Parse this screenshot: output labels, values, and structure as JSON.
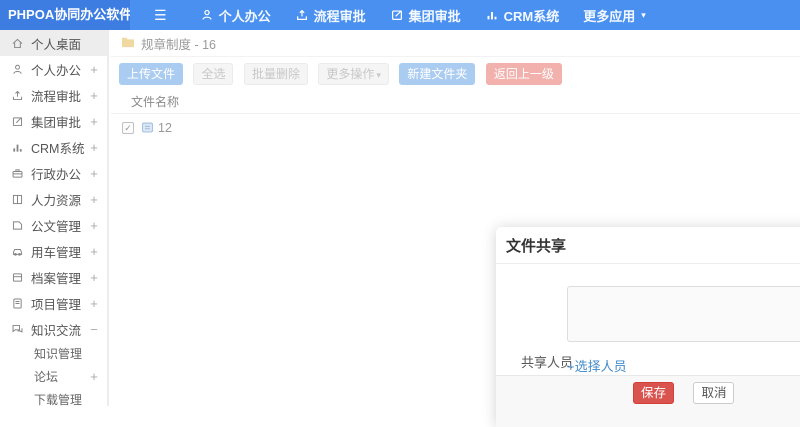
{
  "topbar": {
    "logo": "PHPOA协同办公软件",
    "hamburger_glyph": "☰",
    "nav": [
      {
        "label": "个人办公",
        "icon": "user-icon"
      },
      {
        "label": "流程审批",
        "icon": "workflow-icon"
      },
      {
        "label": "集团审批",
        "icon": "approval-icon"
      },
      {
        "label": "CRM系统",
        "icon": "chart-icon"
      },
      {
        "label": "更多应用",
        "icon": "caret-down-icon",
        "caret": "▾"
      }
    ]
  },
  "sidebar": {
    "items": [
      {
        "label": "个人桌面",
        "icon": "home-icon",
        "expander": "",
        "active": true
      },
      {
        "label": "个人办公",
        "icon": "user-icon",
        "expander": "+"
      },
      {
        "label": "流程审批",
        "icon": "workflow-icon",
        "expander": "+"
      },
      {
        "label": "集团审批",
        "icon": "approval-icon",
        "expander": "+"
      },
      {
        "label": "CRM系统",
        "icon": "chart-icon",
        "expander": "+"
      },
      {
        "label": "行政办公",
        "icon": "briefcase-icon",
        "expander": "+"
      },
      {
        "label": "人力资源",
        "icon": "book-icon",
        "expander": "+"
      },
      {
        "label": "公文管理",
        "icon": "document-icon",
        "expander": "+"
      },
      {
        "label": "用车管理",
        "icon": "car-icon",
        "expander": "+"
      },
      {
        "label": "档案管理",
        "icon": "archive-icon",
        "expander": "+"
      },
      {
        "label": "项目管理",
        "icon": "project-icon",
        "expander": "+"
      },
      {
        "label": "知识交流",
        "icon": "chat-icon",
        "expander": "−",
        "expanded": true
      }
    ],
    "subitems": [
      {
        "label": "知识管理",
        "expander": ""
      },
      {
        "label": "论坛",
        "expander": "+"
      },
      {
        "label": "下载管理",
        "expander": ""
      }
    ]
  },
  "breadcrumb": {
    "icon": "folder-icon",
    "label": "规章制度 - 16"
  },
  "toolbar": {
    "upload": "上传文件",
    "select_all": "全选",
    "batch_delete": "批量删除",
    "more_actions": "更多操作",
    "more_caret": "▾",
    "new_folder": "新建文件夹",
    "go_back": "返回上一级"
  },
  "file_table": {
    "name_header": "文件名称",
    "rows": [
      {
        "name": "12",
        "checked": true,
        "check_glyph": "✓",
        "icon": "file-icon"
      }
    ]
  },
  "modal": {
    "title": "文件共享",
    "share_label": "共享人员",
    "textarea_value": "",
    "select_people": "+选择人员",
    "save": "保存",
    "cancel": "取消"
  },
  "colors": {
    "topbar_blue": "#4a90f0",
    "logo_blue": "#3d7de2",
    "light_blue_button": "#abccf1",
    "light_red_button": "#f2b1ad",
    "save_red": "#d9534f",
    "link_blue": "#428bca",
    "folder_yellow": "#f0d9a0"
  }
}
